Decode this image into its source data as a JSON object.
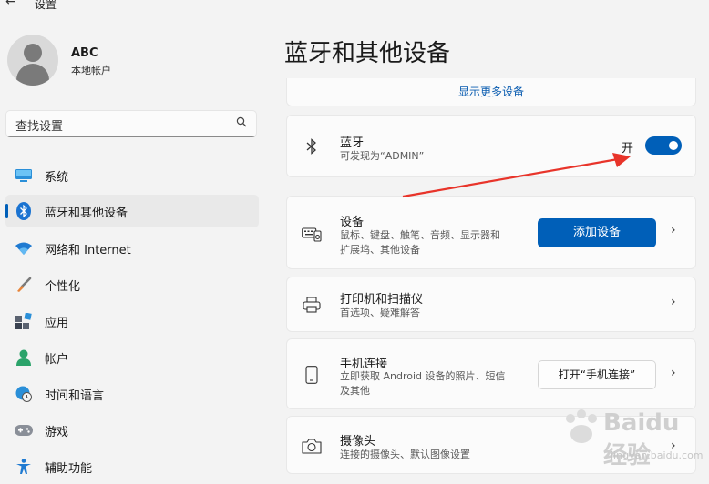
{
  "window": {
    "back_glyph": "←",
    "title": "设置"
  },
  "profile": {
    "name": "ABC",
    "account_type": "本地帐户"
  },
  "search": {
    "placeholder": "查找设置"
  },
  "sidebar": {
    "items": [
      {
        "label": "系统",
        "icon": "monitor-icon"
      },
      {
        "label": "蓝牙和其他设备",
        "icon": "bluetooth-icon",
        "selected": true
      },
      {
        "label": "网络和 Internet",
        "icon": "wifi-icon"
      },
      {
        "label": "个性化",
        "icon": "brush-icon"
      },
      {
        "label": "应用",
        "icon": "apps-icon"
      },
      {
        "label": "帐户",
        "icon": "person-icon"
      },
      {
        "label": "时间和语言",
        "icon": "globe-clock-icon"
      },
      {
        "label": "游戏",
        "icon": "gamepad-icon"
      },
      {
        "label": "辅助功能",
        "icon": "accessibility-icon"
      }
    ]
  },
  "main": {
    "title": "蓝牙和其他设备",
    "show_more_devices": "显示更多设备",
    "bluetooth": {
      "title": "蓝牙",
      "subtitle": "可发现为“ADMIN”",
      "state_label": "开",
      "enabled": true
    },
    "devices": {
      "title": "设备",
      "subtitle_line1": "鼠标、键盘、触笔、音频、显示器和",
      "subtitle_line2": "扩展坞、其他设备",
      "button": "添加设备"
    },
    "printers": {
      "title": "打印机和扫描仪",
      "subtitle": "首选项、疑难解答"
    },
    "phone_link": {
      "title": "手机连接",
      "subtitle_line1": "立即获取 Android 设备的照片、短信",
      "subtitle_line2": "及其他",
      "button": "打开“手机连接”"
    },
    "camera": {
      "title": "摄像头",
      "subtitle": "连接的摄像头、默认图像设置"
    }
  },
  "chevron_glyph": "›",
  "watermark": {
    "brand": "Baidu经验",
    "url": "jingyan.baidu.com"
  },
  "colors": {
    "accent": "#005fb8",
    "arrow": "#e8342a",
    "background": "#f3f3f3",
    "card": "#fbfbfb"
  }
}
